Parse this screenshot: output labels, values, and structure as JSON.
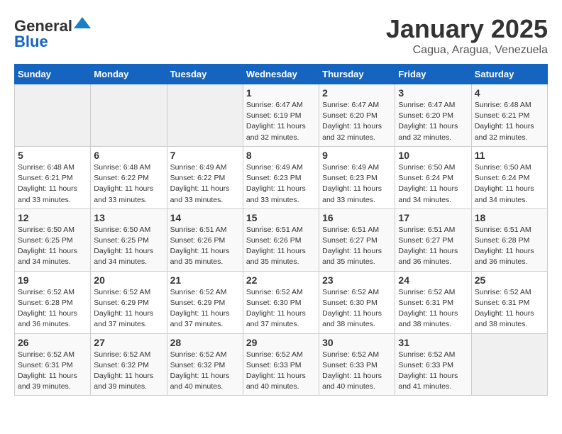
{
  "header": {
    "logo_general": "General",
    "logo_blue": "Blue",
    "month": "January 2025",
    "location": "Cagua, Aragua, Venezuela"
  },
  "weekdays": [
    "Sunday",
    "Monday",
    "Tuesday",
    "Wednesday",
    "Thursday",
    "Friday",
    "Saturday"
  ],
  "weeks": [
    [
      {
        "day": "",
        "info": ""
      },
      {
        "day": "",
        "info": ""
      },
      {
        "day": "",
        "info": ""
      },
      {
        "day": "1",
        "info": "Sunrise: 6:47 AM\nSunset: 6:19 PM\nDaylight: 11 hours and 32 minutes."
      },
      {
        "day": "2",
        "info": "Sunrise: 6:47 AM\nSunset: 6:20 PM\nDaylight: 11 hours and 32 minutes."
      },
      {
        "day": "3",
        "info": "Sunrise: 6:47 AM\nSunset: 6:20 PM\nDaylight: 11 hours and 32 minutes."
      },
      {
        "day": "4",
        "info": "Sunrise: 6:48 AM\nSunset: 6:21 PM\nDaylight: 11 hours and 32 minutes."
      }
    ],
    [
      {
        "day": "5",
        "info": "Sunrise: 6:48 AM\nSunset: 6:21 PM\nDaylight: 11 hours and 33 minutes."
      },
      {
        "day": "6",
        "info": "Sunrise: 6:48 AM\nSunset: 6:22 PM\nDaylight: 11 hours and 33 minutes."
      },
      {
        "day": "7",
        "info": "Sunrise: 6:49 AM\nSunset: 6:22 PM\nDaylight: 11 hours and 33 minutes."
      },
      {
        "day": "8",
        "info": "Sunrise: 6:49 AM\nSunset: 6:23 PM\nDaylight: 11 hours and 33 minutes."
      },
      {
        "day": "9",
        "info": "Sunrise: 6:49 AM\nSunset: 6:23 PM\nDaylight: 11 hours and 33 minutes."
      },
      {
        "day": "10",
        "info": "Sunrise: 6:50 AM\nSunset: 6:24 PM\nDaylight: 11 hours and 34 minutes."
      },
      {
        "day": "11",
        "info": "Sunrise: 6:50 AM\nSunset: 6:24 PM\nDaylight: 11 hours and 34 minutes."
      }
    ],
    [
      {
        "day": "12",
        "info": "Sunrise: 6:50 AM\nSunset: 6:25 PM\nDaylight: 11 hours and 34 minutes."
      },
      {
        "day": "13",
        "info": "Sunrise: 6:50 AM\nSunset: 6:25 PM\nDaylight: 11 hours and 34 minutes."
      },
      {
        "day": "14",
        "info": "Sunrise: 6:51 AM\nSunset: 6:26 PM\nDaylight: 11 hours and 35 minutes."
      },
      {
        "day": "15",
        "info": "Sunrise: 6:51 AM\nSunset: 6:26 PM\nDaylight: 11 hours and 35 minutes."
      },
      {
        "day": "16",
        "info": "Sunrise: 6:51 AM\nSunset: 6:27 PM\nDaylight: 11 hours and 35 minutes."
      },
      {
        "day": "17",
        "info": "Sunrise: 6:51 AM\nSunset: 6:27 PM\nDaylight: 11 hours and 36 minutes."
      },
      {
        "day": "18",
        "info": "Sunrise: 6:51 AM\nSunset: 6:28 PM\nDaylight: 11 hours and 36 minutes."
      }
    ],
    [
      {
        "day": "19",
        "info": "Sunrise: 6:52 AM\nSunset: 6:28 PM\nDaylight: 11 hours and 36 minutes."
      },
      {
        "day": "20",
        "info": "Sunrise: 6:52 AM\nSunset: 6:29 PM\nDaylight: 11 hours and 37 minutes."
      },
      {
        "day": "21",
        "info": "Sunrise: 6:52 AM\nSunset: 6:29 PM\nDaylight: 11 hours and 37 minutes."
      },
      {
        "day": "22",
        "info": "Sunrise: 6:52 AM\nSunset: 6:30 PM\nDaylight: 11 hours and 37 minutes."
      },
      {
        "day": "23",
        "info": "Sunrise: 6:52 AM\nSunset: 6:30 PM\nDaylight: 11 hours and 38 minutes."
      },
      {
        "day": "24",
        "info": "Sunrise: 6:52 AM\nSunset: 6:31 PM\nDaylight: 11 hours and 38 minutes."
      },
      {
        "day": "25",
        "info": "Sunrise: 6:52 AM\nSunset: 6:31 PM\nDaylight: 11 hours and 38 minutes."
      }
    ],
    [
      {
        "day": "26",
        "info": "Sunrise: 6:52 AM\nSunset: 6:31 PM\nDaylight: 11 hours and 39 minutes."
      },
      {
        "day": "27",
        "info": "Sunrise: 6:52 AM\nSunset: 6:32 PM\nDaylight: 11 hours and 39 minutes."
      },
      {
        "day": "28",
        "info": "Sunrise: 6:52 AM\nSunset: 6:32 PM\nDaylight: 11 hours and 40 minutes."
      },
      {
        "day": "29",
        "info": "Sunrise: 6:52 AM\nSunset: 6:33 PM\nDaylight: 11 hours and 40 minutes."
      },
      {
        "day": "30",
        "info": "Sunrise: 6:52 AM\nSunset: 6:33 PM\nDaylight: 11 hours and 40 minutes."
      },
      {
        "day": "31",
        "info": "Sunrise: 6:52 AM\nSunset: 6:33 PM\nDaylight: 11 hours and 41 minutes."
      },
      {
        "day": "",
        "info": ""
      }
    ]
  ]
}
